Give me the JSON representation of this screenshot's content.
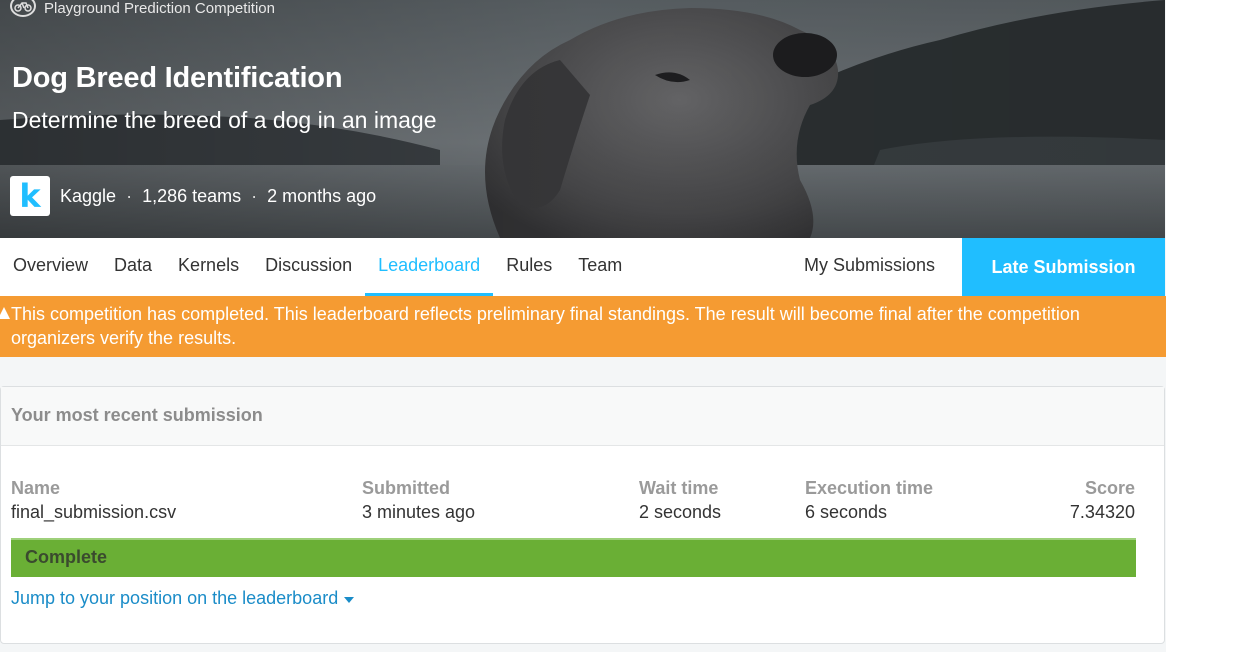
{
  "hero": {
    "competition_type": "Playground Prediction Competition",
    "competition_type_icon": "bicycle-icon",
    "title": "Dog Breed Identification",
    "subtitle": "Determine the breed of a dog in an image",
    "host_logo_letter": "k",
    "host": "Kaggle",
    "teams": "1,286 teams",
    "age": "2 months ago",
    "separator": "·"
  },
  "nav": {
    "tabs": [
      {
        "label": "Overview",
        "active": false
      },
      {
        "label": "Data",
        "active": false
      },
      {
        "label": "Kernels",
        "active": false
      },
      {
        "label": "Discussion",
        "active": false
      },
      {
        "label": "Leaderboard",
        "active": true
      },
      {
        "label": "Rules",
        "active": false
      },
      {
        "label": "Team",
        "active": false
      }
    ],
    "my_submissions": "My Submissions",
    "late_submission": "Late Submission"
  },
  "warning": {
    "icon": "warning-icon",
    "text": "This competition has completed. This leaderboard reflects preliminary final standings. The result will become final after the competition organizers verify the results."
  },
  "submission": {
    "header": "Your most recent submission",
    "columns": {
      "name": {
        "label": "Name",
        "value": "final_submission.csv"
      },
      "submitted": {
        "label": "Submitted",
        "value": "3 minutes ago"
      },
      "wait": {
        "label": "Wait time",
        "value": "2 seconds"
      },
      "execution": {
        "label": "Execution time",
        "value": "6 seconds"
      },
      "score": {
        "label": "Score",
        "value": "7.34320"
      }
    },
    "status": "Complete",
    "jump_link": "Jump to your position on the leaderboard"
  },
  "colors": {
    "accent": "#20beff",
    "warning": "#f59b32",
    "complete": "#6aaf35",
    "link": "#1a8cc8"
  }
}
